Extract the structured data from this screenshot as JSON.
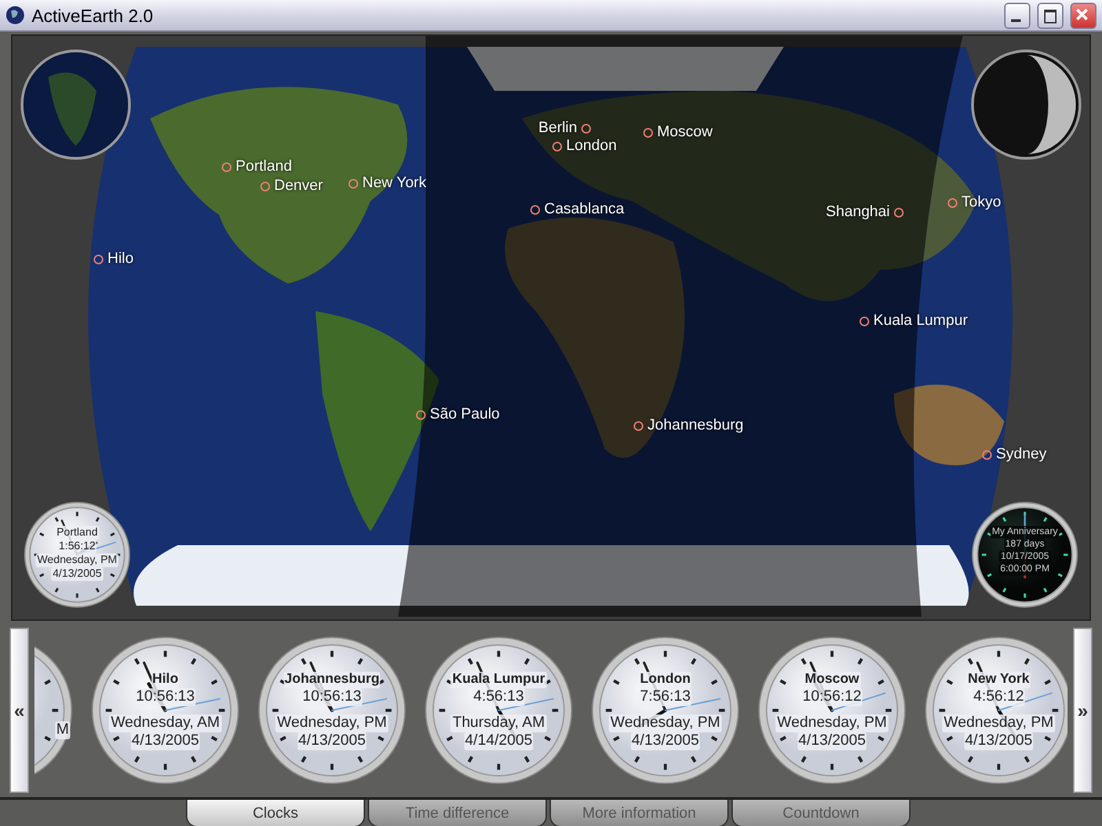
{
  "window": {
    "title": "ActiveEarth 2.0"
  },
  "map": {
    "cities": [
      "Portland",
      "Denver",
      "New York",
      "Hilo",
      "Berlin",
      "London",
      "Moscow",
      "Casablanca",
      "Shanghai",
      "Tokyo",
      "Kuala Lumpur",
      "São Paulo",
      "Johannesburg",
      "Sydney"
    ],
    "local_clock": {
      "city": "Portland",
      "time": "1:56:12",
      "day": "Wednesday, PM",
      "date": "4/13/2005"
    },
    "countdown_clock": {
      "title": "My Anniversary",
      "remaining": "187 days",
      "date": "10/17/2005",
      "time": "6:00:00 PM"
    }
  },
  "clock_strip": {
    "scroll_left": "«",
    "scroll_right": "»",
    "partial_clock": {
      "text": "M"
    },
    "clocks": [
      {
        "city": "Hilo",
        "time": "10:56:13",
        "day": "Wednesday, AM",
        "date": "4/13/2005"
      },
      {
        "city": "Johannesburg",
        "time": "10:56:13",
        "day": "Wednesday, PM",
        "date": "4/13/2005"
      },
      {
        "city": "Kuala Lumpur",
        "time": "4:56:13",
        "day": "Thursday, AM",
        "date": "4/14/2005"
      },
      {
        "city": "London",
        "time": "7:56:13",
        "day": "Wednesday, PM",
        "date": "4/13/2005"
      },
      {
        "city": "Moscow",
        "time": "10:56:12",
        "day": "Wednesday, PM",
        "date": "4/13/2005"
      },
      {
        "city": "New York",
        "time": "4:56:12",
        "day": "Wednesday, PM",
        "date": "4/13/2005"
      }
    ]
  },
  "tabs": [
    {
      "label": "Clocks",
      "selected": true
    },
    {
      "label": "Time difference",
      "selected": false
    },
    {
      "label": "More information",
      "selected": false
    },
    {
      "label": "Countdown",
      "selected": false
    }
  ]
}
